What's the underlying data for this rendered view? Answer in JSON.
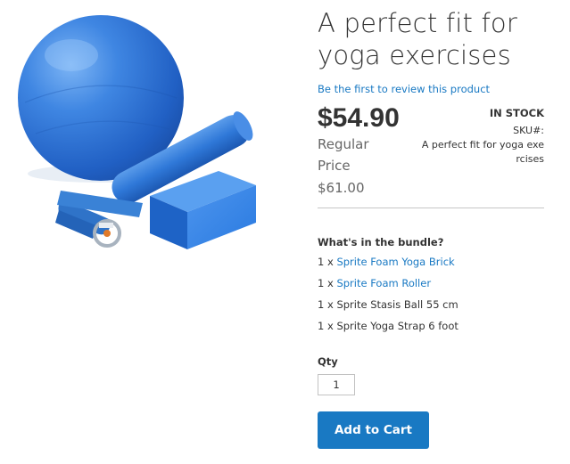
{
  "product": {
    "title": "A perfect fit for yoga exercises",
    "review_link": "Be the first to review this product",
    "final_price": "$54.90",
    "regular_price_label": "Regular Price",
    "regular_price_value": "$61.00",
    "stock_status": "IN STOCK",
    "sku_label": "SKU#:",
    "sku_value": "A perfect fit for yoga exercises"
  },
  "bundle": {
    "title": "What's in the bundle?",
    "items": [
      {
        "qty": "1 x",
        "name": "Sprite Foam Yoga Brick",
        "is_link": true
      },
      {
        "qty": "1 x",
        "name": "Sprite Foam Roller",
        "is_link": true
      },
      {
        "qty": "1 x",
        "name": "Sprite Stasis Ball 55 cm",
        "is_link": false
      },
      {
        "qty": "1 x",
        "name": "Sprite Yoga Strap 6 foot",
        "is_link": false
      }
    ]
  },
  "cart": {
    "qty_label": "Qty",
    "qty_value": "1",
    "add_to_cart_label": "Add to Cart"
  },
  "colors": {
    "link": "#1979c3",
    "button": "#1979c3",
    "product_blue": "#2a73d6"
  },
  "media": {
    "image_subject": "yoga-ball-roller-brick-strap-photo"
  }
}
